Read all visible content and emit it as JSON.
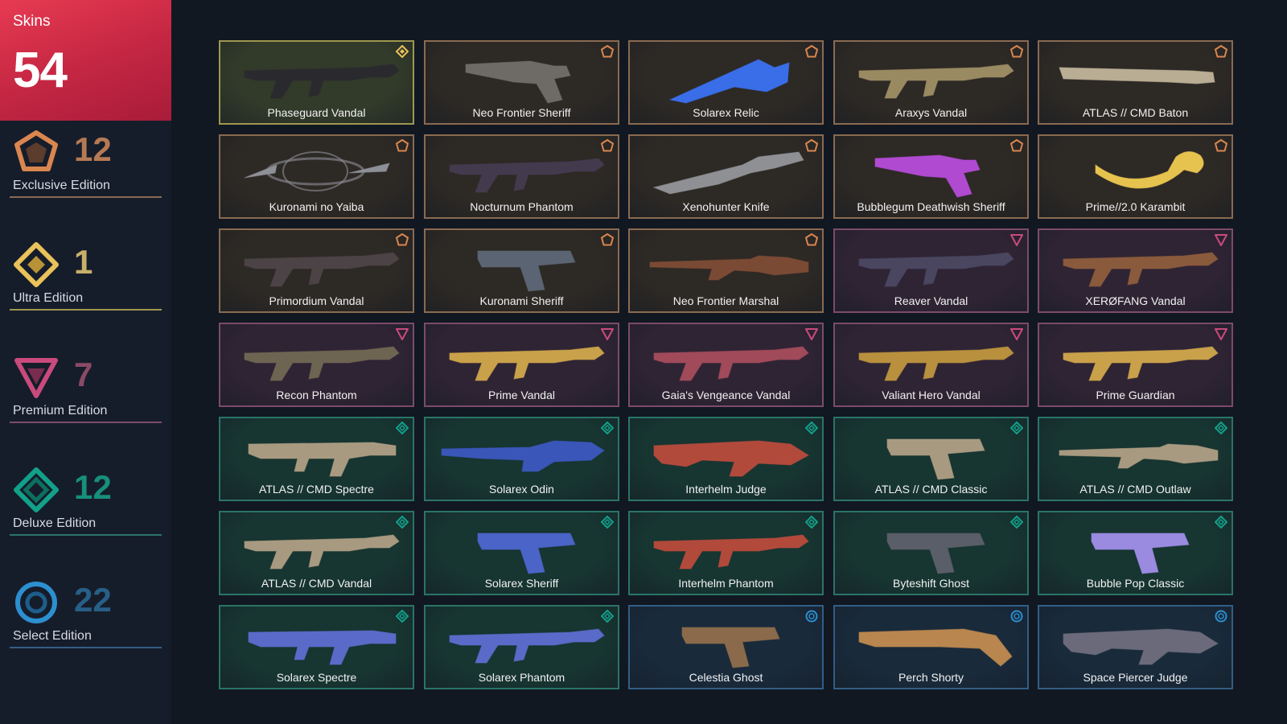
{
  "total": {
    "label": "Skins",
    "count": "54"
  },
  "editions": [
    {
      "key": "exclusive",
      "name": "Exclusive Edition",
      "count": "12",
      "color": "#d9864f"
    },
    {
      "key": "ultra",
      "name": "Ultra Edition",
      "count": "1",
      "color": "#e9c25a"
    },
    {
      "key": "premium",
      "name": "Premium Edition",
      "count": "7",
      "color": "#c94a7c"
    },
    {
      "key": "deluxe",
      "name": "Deluxe Edition",
      "count": "12",
      "color": "#12a08a"
    },
    {
      "key": "select",
      "name": "Select Edition",
      "count": "22",
      "color": "#2c8fd0"
    }
  ],
  "colors": {
    "ultra_bg": "#323a2a",
    "ultra_border": "#9f9750",
    "exclusive_bg": "#2d2925",
    "exclusive_border": "#8a6a50",
    "premium_bg": "#2f2434",
    "premium_border": "#7d4a6c",
    "deluxe_bg": "#173531",
    "deluxe_border": "#2a7468",
    "select_bg": "#192a3b",
    "select_border": "#315e86"
  },
  "skins": [
    {
      "name": "Phaseguard Vandal",
      "tier": "ultra",
      "shape": "rifle",
      "tint": "#2a2a2e"
    },
    {
      "name": "Neo Frontier Sheriff",
      "tier": "exclusive",
      "shape": "revolver",
      "tint": "#6e6a66"
    },
    {
      "name": "Solarex Relic",
      "tier": "exclusive",
      "shape": "crystal",
      "tint": "#3a6ee8"
    },
    {
      "name": "Araxys Vandal",
      "tier": "exclusive",
      "shape": "rifle",
      "tint": "#9a8a62"
    },
    {
      "name": "ATLAS // CMD Baton",
      "tier": "exclusive",
      "shape": "baton",
      "tint": "#b9ad94"
    },
    {
      "name": "Kuronami no Yaiba",
      "tier": "exclusive",
      "shape": "chain",
      "tint": "#8e9098"
    },
    {
      "name": "Nocturnum Phantom",
      "tier": "exclusive",
      "shape": "rifle",
      "tint": "#443a4e"
    },
    {
      "name": "Xenohunter Knife",
      "tier": "exclusive",
      "shape": "knife",
      "tint": "#8e9094"
    },
    {
      "name": "Bubblegum Deathwish Sheriff",
      "tier": "exclusive",
      "shape": "revolver",
      "tint": "#b04ad0"
    },
    {
      "name": "Prime//2.0 Karambit",
      "tier": "exclusive",
      "shape": "karambit",
      "tint": "#e6c34e"
    },
    {
      "name": "Primordium Vandal",
      "tier": "exclusive",
      "shape": "rifle",
      "tint": "#4b4346"
    },
    {
      "name": "Kuronami Sheriff",
      "tier": "exclusive",
      "shape": "pistol",
      "tint": "#5b6472"
    },
    {
      "name": "Neo Frontier Marshal",
      "tier": "exclusive",
      "shape": "sniper",
      "tint": "#7a4a34"
    },
    {
      "name": "Reaver Vandal",
      "tier": "premium",
      "shape": "rifle",
      "tint": "#4a4660"
    },
    {
      "name": "XERØFANG Vandal",
      "tier": "premium",
      "shape": "rifle",
      "tint": "#8a5a3c"
    },
    {
      "name": "Recon Phantom",
      "tier": "premium",
      "shape": "rifle",
      "tint": "#6e6452"
    },
    {
      "name": "Prime Vandal",
      "tier": "premium",
      "shape": "rifle",
      "tint": "#c9a14a"
    },
    {
      "name": "Gaia's Vengeance Vandal",
      "tier": "premium",
      "shape": "rifle",
      "tint": "#a04a5a"
    },
    {
      "name": "Valiant Hero Vandal",
      "tier": "premium",
      "shape": "rifle",
      "tint": "#b8903e"
    },
    {
      "name": "Prime Guardian",
      "tier": "premium",
      "shape": "rifle",
      "tint": "#c9a14a"
    },
    {
      "name": "ATLAS // CMD Spectre",
      "tier": "deluxe",
      "shape": "smg",
      "tint": "#a89a80"
    },
    {
      "name": "Solarex Odin",
      "tier": "deluxe",
      "shape": "lmg",
      "tint": "#3a56b8"
    },
    {
      "name": "Interhelm Judge",
      "tier": "deluxe",
      "shape": "shotgun",
      "tint": "#b24a3c"
    },
    {
      "name": "ATLAS // CMD Classic",
      "tier": "deluxe",
      "shape": "pistol",
      "tint": "#a89a80"
    },
    {
      "name": "ATLAS // CMD Outlaw",
      "tier": "deluxe",
      "shape": "sniper",
      "tint": "#a89a80"
    },
    {
      "name": "ATLAS // CMD Vandal",
      "tier": "deluxe",
      "shape": "rifle",
      "tint": "#a89a80"
    },
    {
      "name": "Solarex Sheriff",
      "tier": "deluxe",
      "shape": "pistol",
      "tint": "#4a64c8"
    },
    {
      "name": "Interhelm Phantom",
      "tier": "deluxe",
      "shape": "rifle",
      "tint": "#b24a3c"
    },
    {
      "name": "Byteshift Ghost",
      "tier": "deluxe",
      "shape": "pistol",
      "tint": "#5a5e68"
    },
    {
      "name": "Bubble Pop Classic",
      "tier": "deluxe",
      "shape": "pistol",
      "tint": "#9a8ae0"
    },
    {
      "name": "Solarex Spectre",
      "tier": "deluxe",
      "shape": "smg",
      "tint": "#5a6ac8"
    },
    {
      "name": "Solarex Phantom",
      "tier": "deluxe",
      "shape": "rifle",
      "tint": "#5a6ac8"
    },
    {
      "name": "Celestia Ghost",
      "tier": "select",
      "shape": "pistol",
      "tint": "#8a6a4a"
    },
    {
      "name": "Perch Shorty",
      "tier": "select",
      "shape": "shorty",
      "tint": "#b8864e"
    },
    {
      "name": "Space Piercer Judge",
      "tier": "select",
      "shape": "shotgun",
      "tint": "#6a6a7a"
    }
  ]
}
